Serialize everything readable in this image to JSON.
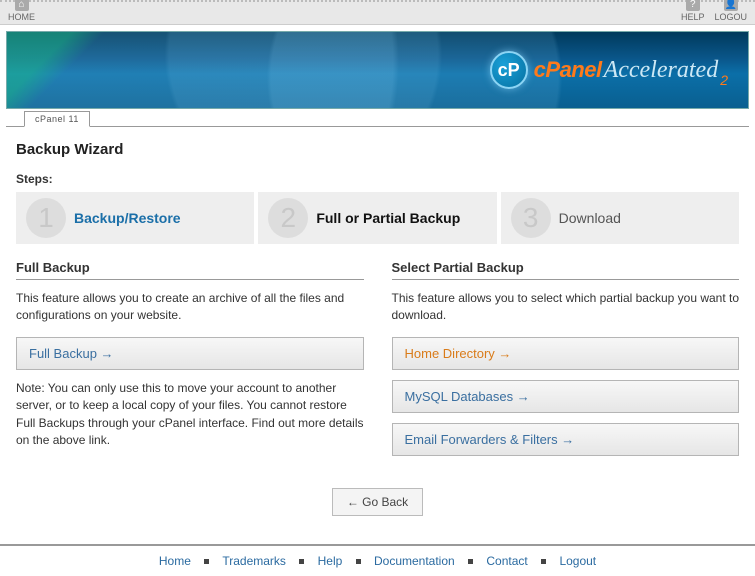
{
  "topbar": {
    "home": "HOME",
    "help": "HELP",
    "logout": "LOGOU"
  },
  "banner": {
    "cpanel": "cPanel",
    "accelerated": "Accelerated",
    "sub": "2"
  },
  "tab": "cPanel 11",
  "page": {
    "title": "Backup Wizard",
    "steps_label": "Steps:",
    "steps": [
      {
        "num": "1",
        "title": "Backup/Restore"
      },
      {
        "num": "2",
        "title": "Full or Partial Backup"
      },
      {
        "num": "3",
        "title": "Download"
      }
    ],
    "full": {
      "heading": "Full Backup",
      "desc": "This feature allows you to create an archive of all the files and configurations on your website.",
      "button": "Full Backup →",
      "note": "Note: You can only use this to move your account to another server, or to keep a local copy of your files. You cannot restore Full Backups through your cPanel interface. Find out more details on the above link."
    },
    "partial": {
      "heading": "Select Partial Backup",
      "desc": "This feature allows you to select which partial backup you want to download.",
      "buttons": [
        "Home Directory →",
        "MySQL Databases →",
        "Email Forwarders & Filters →"
      ]
    },
    "goback": "← Go Back"
  },
  "footer": {
    "links": [
      "Home",
      "Trademarks",
      "Help",
      "Documentation",
      "Contact",
      "Logout"
    ]
  }
}
